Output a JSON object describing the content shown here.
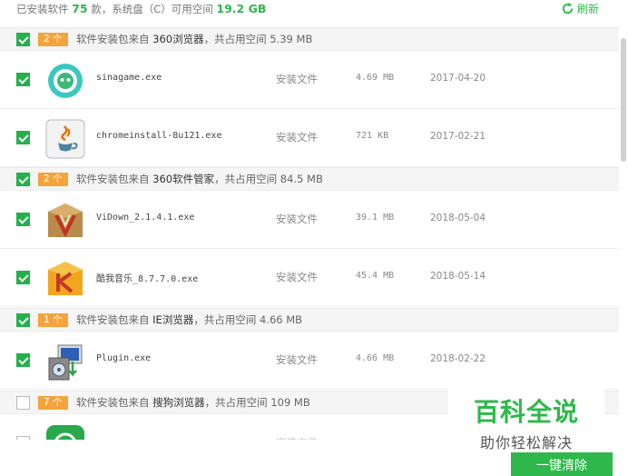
{
  "summary": {
    "installed_prefix": "已安装软件",
    "installed_count": "75",
    "installed_suffix": "款，系统盘（C）可用空间",
    "free_space": "19.2 GB"
  },
  "refresh_label": "刷新",
  "groups": [
    {
      "count_label": "2 个",
      "checked": true,
      "text_prefix": "软件安装包来自",
      "source": "360浏览器",
      "text_suffix": "，共占用空间 5.39 MB",
      "items": [
        {
          "name": "sinagame.exe",
          "type": "安装文件",
          "size": "4.69 MB",
          "date": "2017-04-20",
          "icon": "sinagame-icon",
          "checked": true
        },
        {
          "name": "chromeinstall-8u121.exe",
          "type": "安装文件",
          "size": "721 KB",
          "date": "2017-02-21",
          "icon": "java-icon",
          "checked": true
        }
      ]
    },
    {
      "count_label": "2 个",
      "checked": true,
      "text_prefix": "软件安装包来自",
      "source": "360软件管家",
      "text_suffix": "，共占用空间 84.5 MB",
      "items": [
        {
          "name": "ViDown_2.1.4.1.exe",
          "type": "安装文件",
          "size": "39.1 MB",
          "date": "2018-05-04",
          "icon": "vidown-icon",
          "checked": true
        },
        {
          "name": "酷我音乐_8.7.7.0.exe",
          "type": "安装文件",
          "size": "45.4 MB",
          "date": "2018-05-14",
          "icon": "kuwo-music-icon",
          "checked": true
        }
      ]
    },
    {
      "count_label": "1 个",
      "checked": true,
      "text_prefix": "软件安装包来自",
      "source": "IE浏览器",
      "text_suffix": "，共占用空间 4.66 MB",
      "items": [
        {
          "name": "Plugin.exe",
          "type": "安装文件",
          "size": "4.66 MB",
          "date": "2018-02-22",
          "icon": "plugin-installer-icon",
          "checked": true
        }
      ]
    },
    {
      "count_label": "7 个",
      "checked": false,
      "text_prefix": "软件安装包来自",
      "source": "搜狗浏览器",
      "text_suffix": "，共占用空间 109 MB",
      "items": [
        {
          "name": "",
          "type": "安装文件",
          "size": "",
          "date": "",
          "icon": "green-app-icon",
          "checked": false
        }
      ]
    }
  ],
  "watermark": {
    "title": "百科全说",
    "subtitle": "助你轻松解决"
  },
  "clean_button_label": "一键清除",
  "colors": {
    "accent_green": "#2fb84a",
    "count_badge": "#f4a43c",
    "checkbox_green": "#24b04a"
  }
}
